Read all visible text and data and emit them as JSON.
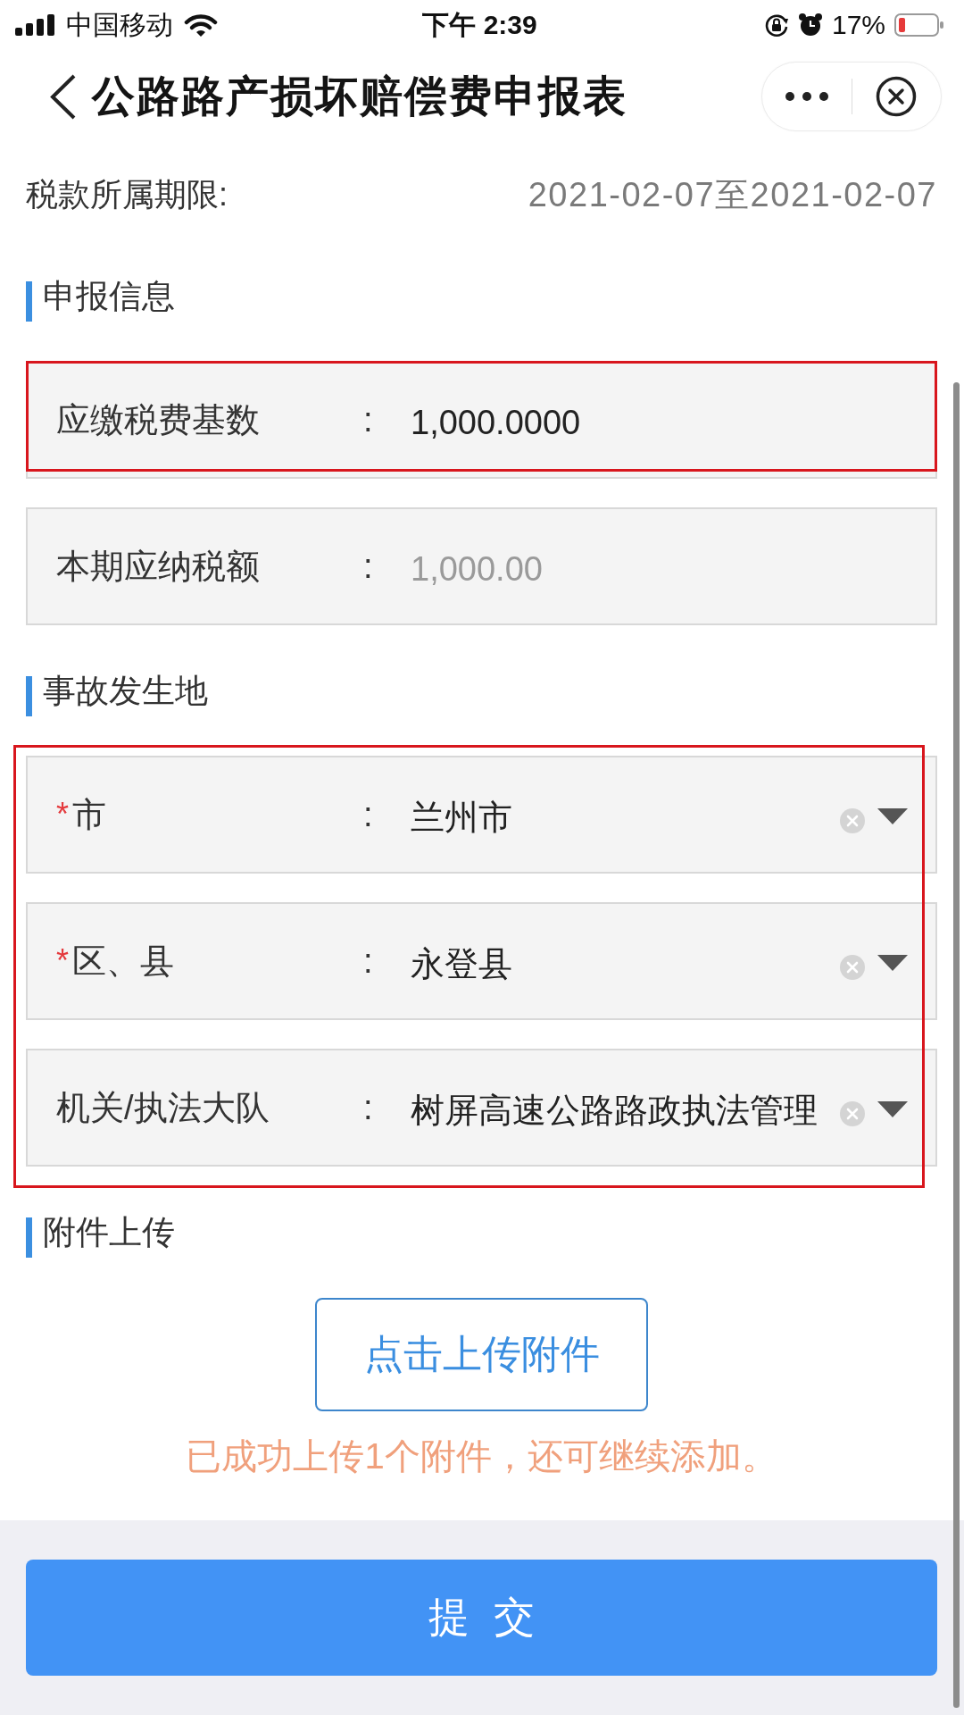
{
  "status_bar": {
    "carrier": "中国移动",
    "time": "下午 2:39",
    "battery": "17%"
  },
  "header": {
    "title": "公路路产损坏赔偿费申报表"
  },
  "tax_period": {
    "label": "税款所属期限:",
    "value": "2021-02-07至2021-02-07"
  },
  "sections": [
    {
      "title": "申报信息",
      "groups": [
        {
          "highlighted": true,
          "fields": [
            {
              "kind": "text",
              "label": "应缴税费基数",
              "separator": ":",
              "value": "1,000.0000",
              "disabled": false
            }
          ]
        },
        {
          "highlighted": false,
          "fields": [
            {
              "kind": "text",
              "label": "本期应纳税额",
              "separator": ":",
              "value": "1,000.00",
              "disabled": true
            }
          ]
        }
      ]
    },
    {
      "title": "事故发生地",
      "groups": [
        {
          "highlighted": true,
          "fields": [
            {
              "kind": "select",
              "required_mark": "*",
              "label": "市",
              "separator": ":",
              "value": "兰州市",
              "disabled": false
            },
            {
              "kind": "select",
              "required_mark": "*",
              "label": "区、县",
              "separator": ":",
              "value": "永登县",
              "disabled": false
            },
            {
              "kind": "select",
              "label": "机关/执法大队",
              "separator": ":",
              "value": "树屏高速公路路政执法管理",
              "disabled": false
            }
          ]
        }
      ]
    },
    {
      "title": "附件上传",
      "upload": {
        "button": "点击上传附件",
        "message": "已成功上传1个附件，还可继续添加。"
      }
    }
  ],
  "submit": {
    "label": "提交"
  }
}
